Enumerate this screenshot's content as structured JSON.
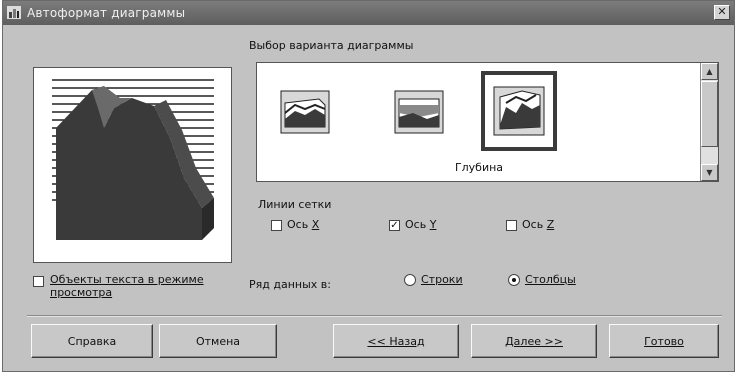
{
  "window": {
    "title": "Автоформат диаграммы"
  },
  "variants": {
    "heading": "Выбор варианта диаграммы",
    "items": [
      {
        "icon": "3d-area-chart-icon"
      },
      {
        "icon": "3d-stacked-area-chart-icon"
      },
      {
        "icon": "3d-depth-area-chart-icon",
        "selected": true
      }
    ],
    "selected_caption": "Глубина"
  },
  "gridlines": {
    "heading": "Линии сетки",
    "axes": [
      {
        "label_pre": "Ось ",
        "label_key": "X",
        "checked": false
      },
      {
        "label_pre": "Ось ",
        "label_key": "Y",
        "checked": true
      },
      {
        "label_pre": "Ось ",
        "label_key": "Z",
        "checked": false
      }
    ]
  },
  "text_objects": {
    "label_line1": "Объекты текста в режиме",
    "label_line2": "просмотра",
    "checked": false
  },
  "series_in": {
    "label": "Ряд данных в:",
    "options": [
      {
        "label": "Строки",
        "selected": false
      },
      {
        "label": "Столбцы",
        "selected": true
      }
    ]
  },
  "buttons": {
    "help": "Справка",
    "cancel": "Отмена",
    "back": "<< Назад",
    "next": "Далее >>",
    "finish": "Готово"
  }
}
